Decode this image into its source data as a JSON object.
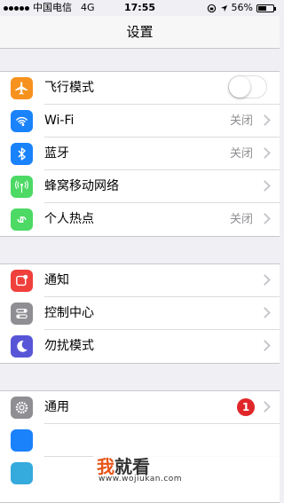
{
  "status_bar": {
    "carrier": "中国电信",
    "network": "4G",
    "time": "17:55",
    "battery": "56%",
    "battery_level": 0.56
  },
  "nav": {
    "title": "设置"
  },
  "groups": [
    {
      "items": [
        {
          "label": "飞行模式",
          "icon": "airplane-icon",
          "color": "#f7921e",
          "control": "toggle",
          "toggle_on": false
        },
        {
          "label": "Wi-Fi",
          "icon": "wifi-icon",
          "color": "#1a82fb",
          "value": "关闭"
        },
        {
          "label": "蓝牙",
          "icon": "bluetooth-icon",
          "color": "#1a82fb",
          "value": "关闭"
        },
        {
          "label": "蜂窝移动网络",
          "icon": "cellular-icon",
          "color": "#4cd964",
          "value": ""
        },
        {
          "label": "个人热点",
          "icon": "hotspot-icon",
          "color": "#4cd964",
          "value": "关闭"
        }
      ]
    },
    {
      "items": [
        {
          "label": "通知",
          "icon": "notifications-icon",
          "color": "#f0403c"
        },
        {
          "label": "控制中心",
          "icon": "control-center-icon",
          "color": "#8e8e93"
        },
        {
          "label": "勿扰模式",
          "icon": "moon-icon",
          "color": "#5856d6"
        }
      ]
    },
    {
      "items": [
        {
          "label": "通用",
          "icon": "gear-icon",
          "color": "#8e8e93",
          "badge": "1"
        }
      ]
    }
  ],
  "watermark": {
    "text_accent": "我",
    "text_main": "就看",
    "url": "www.wojiukan.com"
  }
}
